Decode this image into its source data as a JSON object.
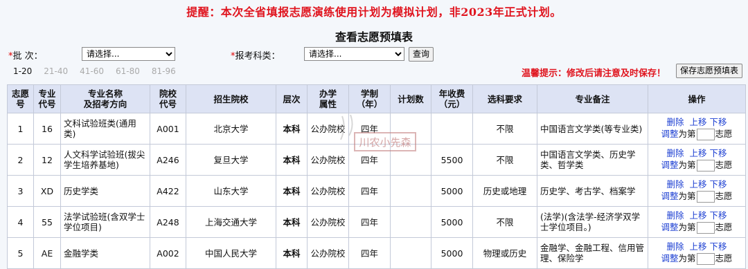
{
  "notice": "提醒：本次全省填报志愿演练使用计划为模拟计划，非2023年正式计划。",
  "title": "查看志愿预填表",
  "filters": {
    "batch_label": "批 次：",
    "batch_value": "请选择...",
    "subject_label": "报考科类：",
    "subject_value": "请选择...",
    "query_button": "查询"
  },
  "pagination": [
    "1-20",
    "21-40",
    "41-60",
    "61-80",
    "81-96"
  ],
  "warm_tip": "温馨提示：修改后请注意及时保存！",
  "save_button": "保存志愿预填表",
  "watermark": "川农小先森",
  "table": {
    "headers": {
      "no_l1": "志愿",
      "no_l2": "号",
      "code_l1": "专业",
      "code_l2": "代号",
      "major_l1": "专业名称",
      "major_l2": "及招考方向",
      "school_code_l1": "院校",
      "school_code_l2": "代号",
      "school": "招生院校",
      "level": "层次",
      "attr_l1": "办学",
      "attr_l2": "属性",
      "years_l1": "学制",
      "years_l2": "（年）",
      "plan": "计划数",
      "fee_l1": "年收费",
      "fee_l2": "（元）",
      "req": "选科要求",
      "remark": "专业备注",
      "ops": "操作"
    },
    "ops": {
      "delete": "删除",
      "up": "上移",
      "down": "下移",
      "adjust": "调整",
      "to": "为第",
      "suffix": "志愿"
    },
    "rows": [
      {
        "no": "1",
        "code": "16",
        "major": "文科试验班类(通用类)",
        "school_code": "A001",
        "school": "北京大学",
        "level": "本科",
        "attr": "公办院校",
        "years": "四年",
        "plan": "",
        "fee": "",
        "req": "不限",
        "remark": "中国语言文学类(等专业类)"
      },
      {
        "no": "2",
        "code": "12",
        "major": "人文科学试验班(拔尖学生培养基地)",
        "school_code": "A246",
        "school": "复旦大学",
        "level": "本科",
        "attr": "公办院校",
        "years": "四年",
        "plan": "",
        "fee": "5500",
        "req": "不限",
        "remark": "中国语言文学类、历史学类、哲学类"
      },
      {
        "no": "3",
        "code": "XD",
        "major": "历史学类",
        "school_code": "A422",
        "school": "山东大学",
        "level": "本科",
        "attr": "公办院校",
        "years": "四年",
        "plan": "",
        "fee": "5000",
        "req": "历史或地理",
        "remark": "历史学、考古学、档案学"
      },
      {
        "no": "4",
        "code": "55",
        "major": "法学试验班(含双学士学位项目)",
        "school_code": "A248",
        "school": "上海交通大学",
        "level": "本科",
        "attr": "公办院校",
        "years": "四年",
        "plan": "",
        "fee": "5000",
        "req": "不限",
        "remark": "(法学)(含法学-经济学双学士学位项目。)"
      },
      {
        "no": "5",
        "code": "AE",
        "major": "金融学类",
        "school_code": "A002",
        "school": "中国人民大学",
        "level": "本科",
        "attr": "公办院校",
        "years": "四年",
        "plan": "",
        "fee": "5000",
        "req": "物理或历史",
        "remark": "金融学、金融工程、信用管理、保险学"
      }
    ]
  }
}
